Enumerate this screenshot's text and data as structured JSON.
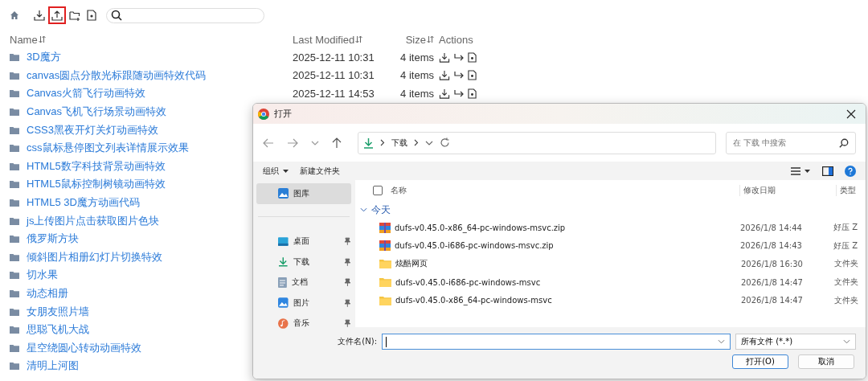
{
  "toolbar": [
    {
      "kind": "home",
      "highlighted": false
    },
    {
      "kind": "download",
      "highlighted": false
    },
    {
      "kind": "upload",
      "highlighted": true
    },
    {
      "kind": "new-folder",
      "highlighted": false
    },
    {
      "kind": "new-file",
      "highlighted": false
    }
  ],
  "search": {
    "kind": "search"
  },
  "table": {
    "columns": [
      "Name",
      "Last Modified",
      "Size",
      "Actions"
    ],
    "rows": [
      {
        "name": "3D魔方",
        "modified": "2025-12-11 10:31",
        "size": "4 items"
      },
      {
        "name": "canvas圆点分散光标跟随动画特效代码",
        "modified": "2025-12-11 10:31",
        "size": "4 items"
      },
      {
        "name": "Canvas火箭飞行动画特效",
        "modified": "2025-12-11 14:53",
        "size": "4 items"
      },
      {
        "name": "Canvas飞机飞行场景动画特效"
      },
      {
        "name": "CSS3黑夜开灯关灯动画特效"
      },
      {
        "name": "css鼠标悬停图文列表详情展示效果"
      },
      {
        "name": "HTML5数字科技背景动画特效"
      },
      {
        "name": "HTML5鼠标控制树镜动画特效"
      },
      {
        "name": "HTML5 3D魔方动画代码"
      },
      {
        "name": "js上传图片点击获取图片色块"
      },
      {
        "name": "俄罗斯方块"
      },
      {
        "name": "倾斜图片相册幻灯片切换特效"
      },
      {
        "name": "切水果"
      },
      {
        "name": "动态相册"
      },
      {
        "name": "女朋友照片墙"
      },
      {
        "name": "思聪飞机大战"
      },
      {
        "name": "星空绕圆心转动动画特效"
      },
      {
        "name": "清明上河图"
      }
    ]
  },
  "dialog": {
    "title": "打开",
    "breadcrumb": [
      "下载"
    ],
    "search_placeholder": "在 下载 中搜索",
    "commands": [
      "组织",
      "新建文件夹"
    ],
    "sidebar": [
      {
        "label": "图库",
        "kind": "gallery",
        "selected": true
      },
      {
        "label": "桌面",
        "kind": "desktop",
        "selected": false
      },
      {
        "label": "下载",
        "kind": "download",
        "selected": false
      },
      {
        "label": "文档",
        "kind": "docs",
        "selected": false
      },
      {
        "label": "图片",
        "kind": "pictures",
        "selected": false
      },
      {
        "label": "音乐",
        "kind": "music",
        "selected": false
      }
    ],
    "columns": [
      "名称",
      "修改日期",
      "类型"
    ],
    "select_all_checked": false,
    "group": "今天",
    "files": [
      {
        "name": "dufs-v0.45.0-x86_64-pc-windows-msvc.zip",
        "date": "2026/1/8 14:44",
        "type": "好压 Z",
        "kind": "zip"
      },
      {
        "name": "dufs-v0.45.0-i686-pc-windows-msvc.zip",
        "date": "2026/1/8 14:43",
        "type": "好压 Z",
        "kind": "zip"
      },
      {
        "name": "炫酷网页",
        "date": "2026/1/8 16:30",
        "type": "文件夹",
        "kind": "folder"
      },
      {
        "name": "dufs-v0.45.0-i686-pc-windows-msvc",
        "date": "2026/1/8 14:47",
        "type": "文件夹",
        "kind": "folder"
      },
      {
        "name": "dufs-v0.45.0-x86_64-pc-windows-msvc",
        "date": "2026/1/8 14:47",
        "type": "文件夹",
        "kind": "folder"
      }
    ],
    "filename_label": "文件名(N):",
    "filetype": "所有文件 (*.*)",
    "buttons": [
      "打开(O)",
      "取消"
    ]
  }
}
